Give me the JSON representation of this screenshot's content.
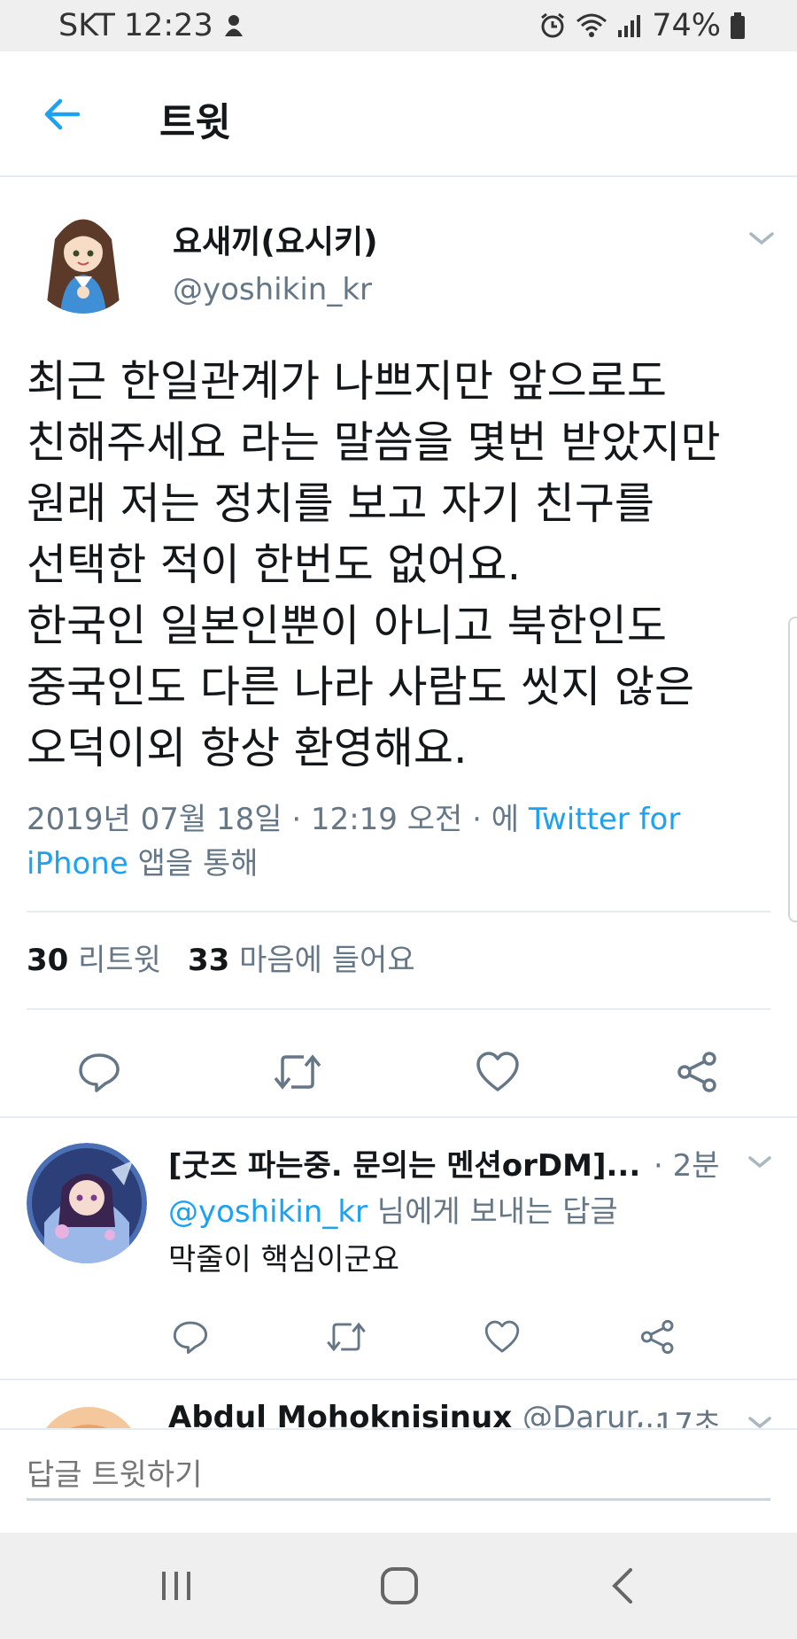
{
  "status_bar": {
    "carrier": "SKT",
    "time": "12:23",
    "battery": "74%"
  },
  "header": {
    "title": "트윗"
  },
  "tweet": {
    "display_name": "요새끼(요시키)",
    "handle": "@yoshikin_kr",
    "text": "최근 한일관계가 나쁘지만 앞으로도\n친해주세요 라는 말씀을 몇번 받았지만\n원래 저는 정치를 보고 자기 친구를\n선택한 적이 한번도 없어요.\n한국인 일본인뿐이 아니고 북한인도\n중국인도 다른 나라 사람도 씻지 않은\n오덕이외 항상 환영해요.",
    "timestamp": "2019년 07월 18일 · 12:19 오전 · 에",
    "source_link": "Twitter for iPhone",
    "source_suffix": "앱을 통해",
    "retweets_count": "30",
    "retweets_label": "리트윗",
    "likes_count": "33",
    "likes_label": "마음에 들어요"
  },
  "replies": [
    {
      "name": "[굿즈 파는중. 문의는 멘션orDM]...",
      "time": "· 2분",
      "reply_to_mention": "@yoshikin_kr",
      "reply_to_suffix": "님에게 보내는 답글",
      "text": "막줄이 핵심이군요"
    },
    {
      "name": "Abdul Mohoknisinux",
      "handle": "@Darur...",
      "time": "· 17초"
    }
  ],
  "compose": {
    "placeholder": "답글 트윗하기"
  },
  "colors": {
    "accent": "#1da1f2",
    "secondary_text": "#657786",
    "divider": "#e6ecf0"
  }
}
